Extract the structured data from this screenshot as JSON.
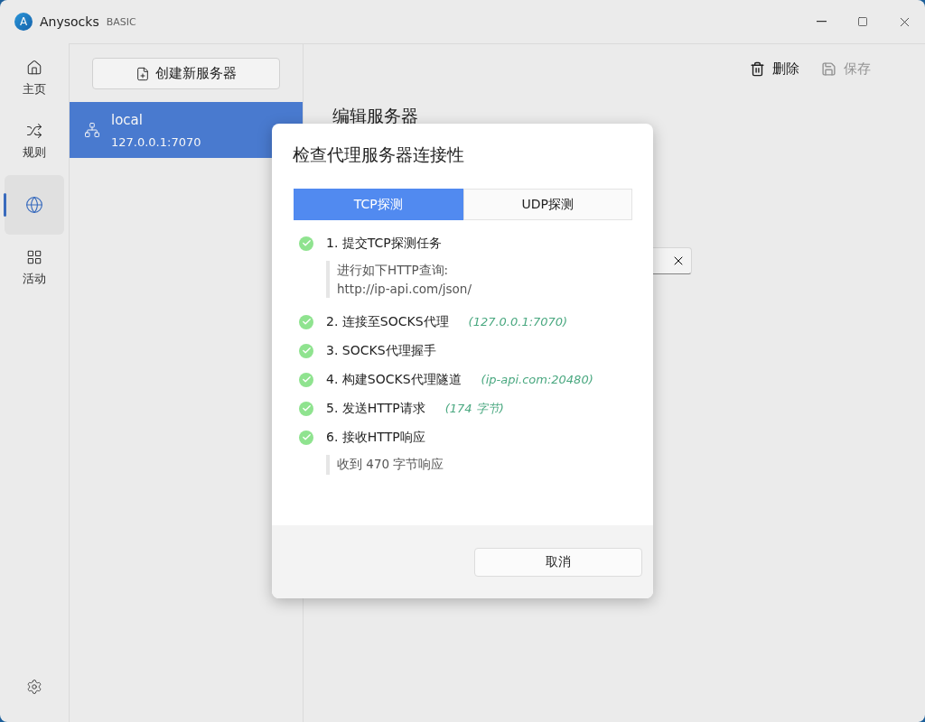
{
  "window": {
    "logo_letter": "A",
    "title": "Anysocks",
    "edition": "BASIC"
  },
  "nav": {
    "items": [
      {
        "kind": "home",
        "label": "主页",
        "selected": false
      },
      {
        "kind": "rules",
        "label": "规则",
        "selected": false
      },
      {
        "kind": "servers",
        "selected": true
      },
      {
        "kind": "activity",
        "label": "活动",
        "selected": false
      }
    ]
  },
  "servers": {
    "create_button": "创建新服务器",
    "items": [
      {
        "name": "local",
        "address": "127.0.0.1:7070",
        "selected": true
      }
    ]
  },
  "toolbar": [
    {
      "kind": "delete",
      "label": "删除",
      "disabled": false
    },
    {
      "kind": "save",
      "label": "保存",
      "disabled": true
    }
  ],
  "editor": {
    "heading": "编辑服务器"
  },
  "dialog": {
    "title": "检查代理服务器连接性",
    "tabs": [
      {
        "label": "TCP探测",
        "selected": true
      },
      {
        "label": "UDP探测",
        "selected": false
      }
    ],
    "steps": [
      {
        "text": "1. 提交TCP探测任务",
        "done": true,
        "note": [
          "进行如下HTTP查询:",
          "http://ip-api.com/json/"
        ]
      },
      {
        "text": "2. 连接至SOCKS代理",
        "done": true,
        "detail": "(127.0.0.1:7070)"
      },
      {
        "text": "3. SOCKS代理握手",
        "done": true
      },
      {
        "text": "4. 构建SOCKS代理隧道",
        "done": true,
        "detail": "(ip-api.com:20480)"
      },
      {
        "text": "5. 发送HTTP请求",
        "done": true,
        "detail": "(174 字节)"
      },
      {
        "text": "6. 接收HTTP响应",
        "done": true,
        "note": [
          "收到 470 字节响应"
        ]
      }
    ],
    "cancel_button": "取消"
  }
}
